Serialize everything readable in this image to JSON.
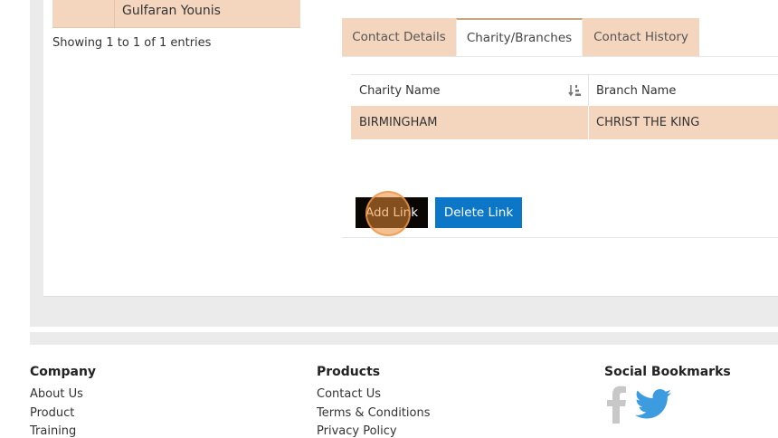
{
  "left_table": {
    "row": {
      "name": "Gulfaran Younis"
    },
    "showing_text": "Showing 1 to 1 of 1 entries"
  },
  "tabs": [
    {
      "label": "Contact Details",
      "active": false
    },
    {
      "label": "Charity/Branches",
      "active": true
    },
    {
      "label": "Contact History",
      "active": false
    }
  ],
  "branches_table": {
    "columns": [
      "Charity Name",
      "Branch Name"
    ],
    "rows": [
      {
        "charity_name": "BIRMINGHAM",
        "branch_name": "CHRIST THE KING"
      }
    ]
  },
  "buttons": {
    "add_link": "Add Link",
    "delete_link": "Delete Link"
  },
  "footer": {
    "company": {
      "heading": "Company",
      "links": [
        "About Us",
        "Product",
        "Training"
      ]
    },
    "products": {
      "heading": "Products",
      "links": [
        "Contact Us",
        "Terms & Conditions",
        "Privacy Policy"
      ]
    },
    "social": {
      "heading": "Social Bookmarks",
      "icons": [
        "facebook-icon",
        "twitter-icon"
      ]
    }
  },
  "colors": {
    "row_highlight": "#f4d6bf",
    "add_button": "#0a0604",
    "delete_button": "#0c77c7",
    "facebook": "#c8c8c8",
    "twitter": "#3d9be0"
  }
}
